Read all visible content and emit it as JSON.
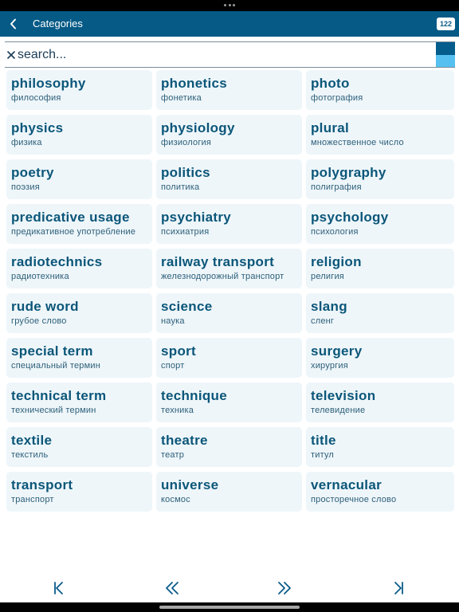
{
  "nav": {
    "title": "Categories",
    "count": "122"
  },
  "search": {
    "placeholder": "search...",
    "value": ""
  },
  "icons": {
    "back": "chevron-left-icon",
    "clear": "close-icon",
    "first": "first-page-icon",
    "prev": "previous-page-icon",
    "next": "next-page-icon",
    "last": "last-page-icon"
  },
  "colors": {
    "accent": "#055a86",
    "cell_background": "#eef6fa",
    "title_text": "#0b5679"
  },
  "categories": [
    {
      "en": "philosophy",
      "ru": "философия"
    },
    {
      "en": "phonetics",
      "ru": "фонетика"
    },
    {
      "en": "photo",
      "ru": "фотография"
    },
    {
      "en": "physics",
      "ru": "физика"
    },
    {
      "en": "physiology",
      "ru": "физиология"
    },
    {
      "en": "plural",
      "ru": "множественное число"
    },
    {
      "en": "poetry",
      "ru": "поэзия"
    },
    {
      "en": "politics",
      "ru": "политика"
    },
    {
      "en": "polygraphy",
      "ru": "полиграфия"
    },
    {
      "en": "predicative usage",
      "ru": "предикативное употребление"
    },
    {
      "en": "psychiatry",
      "ru": "психиатрия"
    },
    {
      "en": "psychology",
      "ru": "психология"
    },
    {
      "en": "radiotechnics",
      "ru": "радиотехника"
    },
    {
      "en": "railway transport",
      "ru": "железнодорожный транспорт"
    },
    {
      "en": "religion",
      "ru": "религия"
    },
    {
      "en": "rude word",
      "ru": "грубое слово"
    },
    {
      "en": "science",
      "ru": "наука"
    },
    {
      "en": "slang",
      "ru": "сленг"
    },
    {
      "en": "special term",
      "ru": "специальный термин"
    },
    {
      "en": "sport",
      "ru": "спорт"
    },
    {
      "en": "surgery",
      "ru": "хирургия"
    },
    {
      "en": "technical term",
      "ru": "технический термин"
    },
    {
      "en": "technique",
      "ru": "техника"
    },
    {
      "en": "television",
      "ru": "телевидение"
    },
    {
      "en": "textile",
      "ru": "текстиль"
    },
    {
      "en": "theatre",
      "ru": "театр"
    },
    {
      "en": "title",
      "ru": "титул"
    },
    {
      "en": "transport",
      "ru": "транспорт"
    },
    {
      "en": "universe",
      "ru": "космос"
    },
    {
      "en": "vernacular",
      "ru": "просторечное слово"
    }
  ]
}
